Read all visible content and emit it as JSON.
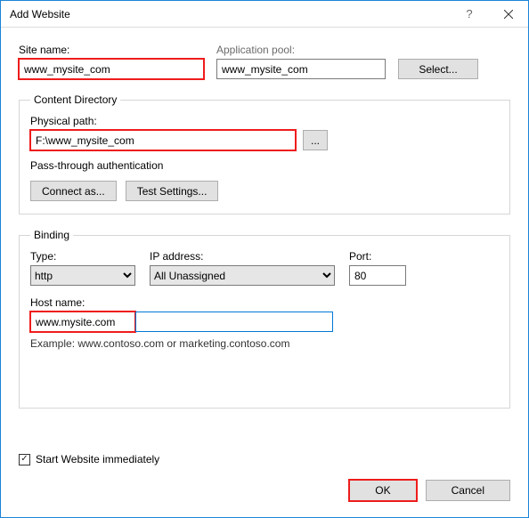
{
  "title": "Add Website",
  "labels": {
    "site_name": "Site name:",
    "app_pool": "Application pool:",
    "select": "Select...",
    "content_dir": "Content Directory",
    "phys_path": "Physical path:",
    "browse": "...",
    "passthrough": "Pass-through authentication",
    "connect_as": "Connect as...",
    "test_settings": "Test Settings...",
    "binding": "Binding",
    "type": "Type:",
    "ip": "IP address:",
    "port": "Port:",
    "host": "Host name:",
    "example": "Example: www.contoso.com or marketing.contoso.com",
    "start_immed": "Start Website immediately",
    "ok": "OK",
    "cancel": "Cancel",
    "help": "?"
  },
  "values": {
    "site_name": "www_mysite_com",
    "app_pool": "www_mysite_com",
    "phys_path": "F:\\www_mysite_com",
    "type": "http",
    "ip": "All Unassigned",
    "port": "80",
    "host": "www.mysite.com",
    "start_immed_checked": true
  }
}
